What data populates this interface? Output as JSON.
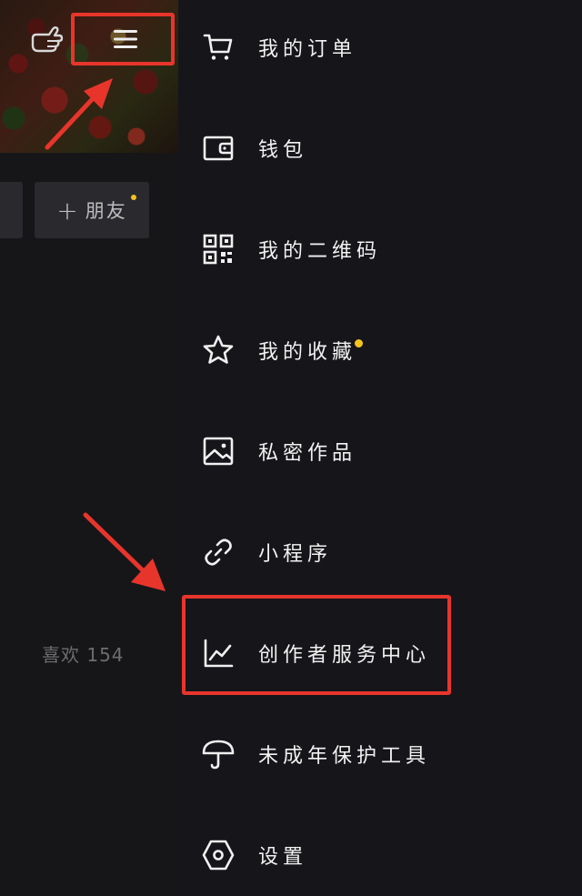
{
  "profile": {
    "add_friend_label": "朋友",
    "add_friend_plus": "+",
    "likes_text": "喜欢 154"
  },
  "drawer": {
    "items": [
      {
        "label": "我的订单",
        "icon": "cart-icon"
      },
      {
        "label": "钱包",
        "icon": "wallet-icon"
      },
      {
        "label": "我的二维码",
        "icon": "qr-code-icon"
      },
      {
        "label": "我的收藏",
        "icon": "star-icon",
        "badge": true
      },
      {
        "label": "私密作品",
        "icon": "image-icon"
      },
      {
        "label": "小程序",
        "icon": "link-icon"
      },
      {
        "label": "创作者服务中心",
        "icon": "chart-icon",
        "highlighted": true
      },
      {
        "label": "未成年保护工具",
        "icon": "umbrella-icon"
      },
      {
        "label": "设置",
        "icon": "hexagon-settings-icon"
      }
    ]
  },
  "colors": {
    "annotation_red": "#e8352b",
    "badge_yellow": "#f4c320",
    "background": "#161619"
  }
}
